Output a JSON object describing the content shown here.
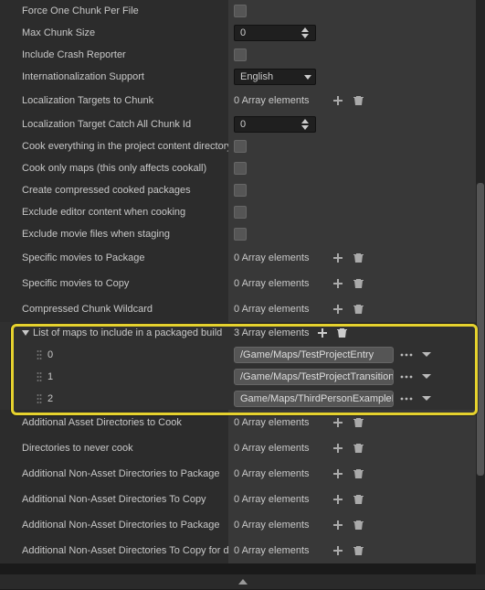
{
  "rows": [
    {
      "label": "Force One Chunk Per File",
      "indent": 1,
      "control": "checkbox"
    },
    {
      "label": "Max Chunk Size",
      "indent": 1,
      "control": "number",
      "value": "0"
    },
    {
      "label": "Include Crash Reporter",
      "indent": 1,
      "control": "checkbox"
    },
    {
      "label": "Internationalization Support",
      "indent": 1,
      "control": "dropdown",
      "value": "English"
    },
    {
      "label": "Localization Targets to Chunk",
      "indent": 1,
      "control": "array",
      "count": "0 Array elements"
    },
    {
      "label": "Localization Target Catch All Chunk Id",
      "indent": 1,
      "control": "number",
      "value": "0"
    },
    {
      "label": "Cook everything in the project content directory",
      "indent": 1,
      "control": "checkbox"
    },
    {
      "label": "Cook only maps (this only affects cookall)",
      "indent": 1,
      "control": "checkbox"
    },
    {
      "label": "Create compressed cooked packages",
      "indent": 1,
      "control": "checkbox"
    },
    {
      "label": "Exclude editor content when cooking",
      "indent": 1,
      "control": "checkbox"
    },
    {
      "label": "Exclude movie files when staging",
      "indent": 1,
      "control": "checkbox"
    },
    {
      "label": "Specific movies to Package",
      "indent": 1,
      "control": "array",
      "count": "0 Array elements"
    },
    {
      "label": "Specific movies to Copy",
      "indent": 1,
      "control": "array",
      "count": "0 Array elements"
    },
    {
      "label": "Compressed Chunk Wildcard",
      "indent": 1,
      "control": "array",
      "count": "0 Array elements"
    }
  ],
  "maps_section": {
    "label": "List of maps to include in a packaged build",
    "count": "3 Array elements",
    "items": [
      {
        "index": "0",
        "path": "/Game/Maps/TestProjectEntry"
      },
      {
        "index": "1",
        "path": "/Game/Maps/TestProjectTransition"
      },
      {
        "index": "2",
        "path": "Game/Maps/ThirdPersonExampleMap"
      }
    ]
  },
  "rows_after": [
    {
      "label": "Additional Asset Directories to Cook",
      "indent": 1,
      "control": "array",
      "count": "0 Array elements"
    },
    {
      "label": "Directories to never cook",
      "indent": 1,
      "control": "array",
      "count": "0 Array elements"
    },
    {
      "label": "Additional Non-Asset Directories to Package",
      "indent": 1,
      "control": "array",
      "count": "0 Array elements"
    },
    {
      "label": "Additional Non-Asset Directories To Copy",
      "indent": 1,
      "control": "array",
      "count": "0 Array elements"
    },
    {
      "label": "Additional Non-Asset Directories to Package",
      "indent": 1,
      "control": "array",
      "count": "0 Array elements"
    },
    {
      "label": "Additional Non-Asset Directories To Copy for dedicated server only",
      "indent": 1,
      "control": "array",
      "count": "0 Array elements"
    }
  ]
}
